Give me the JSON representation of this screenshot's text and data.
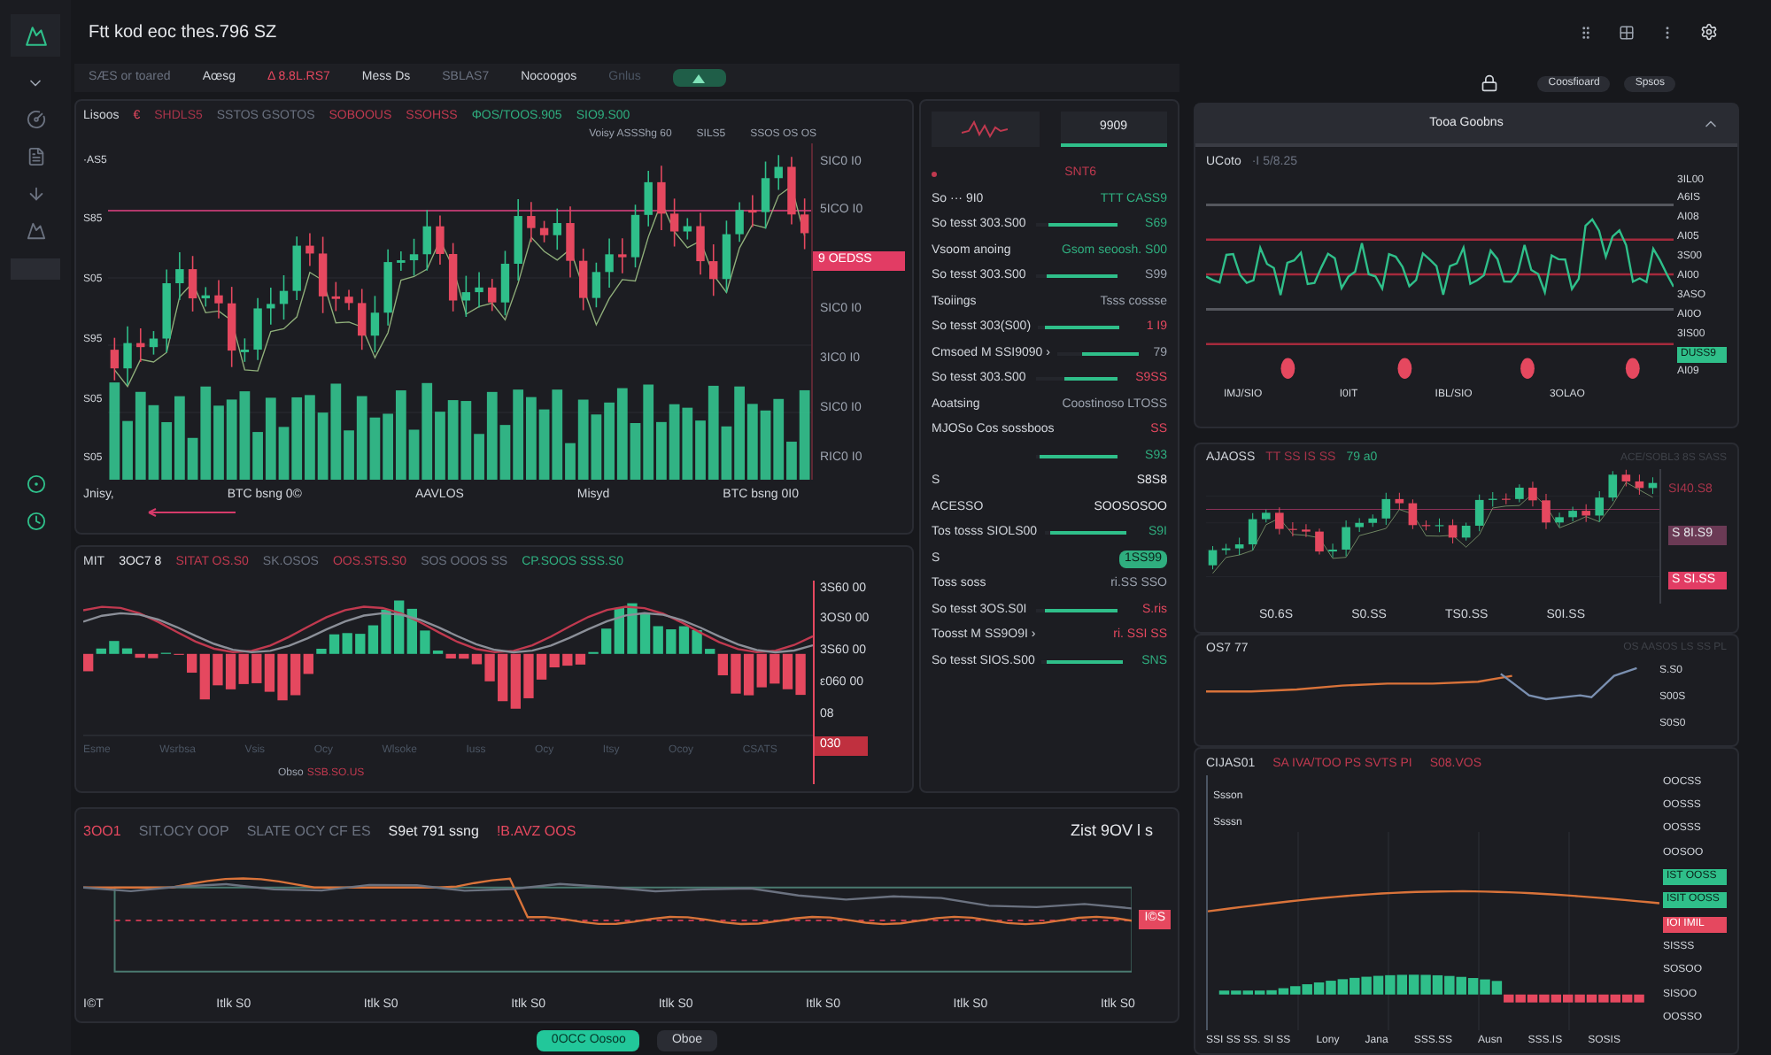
{
  "app": {
    "title": "Ftt kod eoc thes.796 SZ"
  },
  "toolbar": {
    "buttons": [
      "Coosfioard",
      "Spsos"
    ]
  },
  "filters": [
    {
      "label": "SÆS or toared",
      "color": "#6b7280"
    },
    {
      "label": "Aœsg",
      "color": "#d1d5db"
    },
    {
      "label": "Δ 8.8L.RS7",
      "color": "#e5485f"
    },
    {
      "label": "Mess Ds",
      "color": "#d1d5db"
    },
    {
      "label": "SBLAS7",
      "color": "#6b7280"
    },
    {
      "label": "Nocoogos",
      "color": "#d1d5db"
    },
    {
      "label": "Gnlus",
      "color": "#4b5563"
    }
  ],
  "main_chart": {
    "header": [
      {
        "text": "Lisoos",
        "color": "#d1d5db"
      },
      {
        "text": "€",
        "color": "#e5485f"
      },
      {
        "text": "SHDLS5",
        "color": "#a8344a"
      },
      {
        "text": "SSTOS GSOTOS",
        "color": "#6b7280"
      },
      {
        "text": "SOBOOUS",
        "color": "#c0394f"
      },
      {
        "text": "SSOHSS",
        "color": "#c0394f"
      },
      {
        "text": "ΦOS/TOOS.905",
        "color": "#2fae7f"
      },
      {
        "text": "SIO9.S00",
        "color": "#2fae7f"
      }
    ],
    "notes": [
      "Voisy ASSShg 60",
      "SILS5",
      "SSOS OS OS"
    ],
    "left_ticks": [
      "·AS5",
      "S85",
      "S05",
      "S95",
      "S05",
      "S05"
    ],
    "right_ticks": [
      "SIC0 I0",
      "5ICO I0",
      "SIC0 I0",
      "3IC0 I0",
      "SIC0 I0",
      "RIC0 I0"
    ],
    "price_badge": "9 OEDSS",
    "x_labels": [
      "Jnisy,",
      "BTC bsng 0©",
      "AAVLOS",
      "Misyd",
      "BTC bsng 0I0"
    ]
  },
  "macd": {
    "header": [
      {
        "text": "MIT",
        "color": "#d1d5db"
      },
      {
        "text": "3OC7 8",
        "color": "#e5e7eb"
      },
      {
        "text": "SITAT OS.S0",
        "color": "#c0394f"
      },
      {
        "text": "SK.OSOS",
        "color": "#6b7280"
      },
      {
        "text": "OOS.STS.S0",
        "color": "#c0394f"
      },
      {
        "text": "SOS OOOS SS",
        "color": "#6b7280"
      },
      {
        "text": "CP.SOOS SSS.S0",
        "color": "#2fae7f"
      }
    ],
    "right_ticks": [
      "3S60 00",
      "3OS0 00",
      "3S60 00",
      "ε060 00",
      "08"
    ],
    "badge": "030",
    "x_labels": [
      "Esme",
      "Wsrbsa",
      "Vsis",
      "Ocy",
      "Wlsoke",
      "Iuss",
      "Ocy",
      "Itsy",
      "Ocoy",
      "CSATS"
    ],
    "footnote_label": "Obso",
    "footnote_value": "SSB.SO.US"
  },
  "side_panel": {
    "tabs": [
      {
        "kind": "sparkline",
        "selected": false
      },
      {
        "kind": "text",
        "label": "9909",
        "selected": true
      }
    ],
    "rows": [
      {
        "kind": "heading",
        "value": "SNT6",
        "color": "#c0394f"
      },
      {
        "kind": "text",
        "label": "So ··· 9I0",
        "value": "TTT CASS9",
        "color": "#2fae7f"
      },
      {
        "kind": "bar",
        "label": "So tesst 303.S00",
        "level": 0.85,
        "value": "S69",
        "color": "#2fae7f"
      },
      {
        "kind": "text",
        "label": "Vsoom anoing",
        "value": "Gsom seoosh. S00",
        "color": "#2fae7f"
      },
      {
        "kind": "bar",
        "label": "So tesst 303.S00",
        "level": 0.88,
        "value": "S99",
        "color": "#9ca3af"
      },
      {
        "kind": "text",
        "label": "Tsoiings",
        "value": "Tsss cossse",
        "color": "#9ca3af"
      },
      {
        "kind": "bar",
        "label": "So tesst 303(S00)",
        "level": 0.92,
        "value": "1 I9",
        "color": "#e5485f"
      },
      {
        "kind": "bar",
        "label": "Cmsoed M SSI9090 ›",
        "level": 0.7,
        "value": "79",
        "color": "#9ca3af"
      },
      {
        "kind": "bar",
        "label": "So tesst 303.S00",
        "level": 0.65,
        "value": "S9SS",
        "color": "#e5485f"
      },
      {
        "kind": "text",
        "label": "Aoatsing",
        "value": "Coostinoso LTOSS",
        "color": "#9ca3af"
      },
      {
        "kind": "text",
        "label": "MJOSo Cos sossboos",
        "value": "SS",
        "color": "#e5485f"
      },
      {
        "kind": "bar",
        "level": 0.95,
        "value": "S93",
        "color": "#2fae7f"
      },
      {
        "kind": "text",
        "label": "S",
        "value": "S8S8",
        "color": "#e5e7eb"
      },
      {
        "kind": "text",
        "label": "ACESSO",
        "value": "SOOSOSOO",
        "color": "#e5e7eb"
      },
      {
        "kind": "bar",
        "label": "Tos tosss SIOLS00",
        "level": 0.92,
        "value": "S9I",
        "color": "#2fae7f"
      },
      {
        "kind": "badge",
        "label": "S",
        "value": "1SS99",
        "color": "#2fae7f"
      },
      {
        "kind": "text",
        "label": "Toss soss",
        "value": "ri.SS SSO",
        "color": "#9ca3af"
      },
      {
        "kind": "bar",
        "label": "So tesst 3OS.S0I",
        "level": 0.9,
        "value": "S.ris",
        "color": "#e5485f"
      },
      {
        "kind": "text",
        "label": "Toosst M SS9O9I ›",
        "value": "ri. SSI SS",
        "color": "#e5485f"
      },
      {
        "kind": "bar",
        "label": "So tesst SIOS.S00",
        "level": 0.95,
        "value": "SNS",
        "color": "#2fae7f"
      }
    ]
  },
  "timeline": {
    "header": [
      {
        "text": "3OO1",
        "color": "#e5485f"
      },
      {
        "text": "SIT.OCY OOP",
        "color": "#6b7280"
      },
      {
        "text": "SLATE OCY CF ES",
        "color": "#6b7280"
      },
      {
        "text": "S9et 791 ssng",
        "color": "#e5e7eb"
      },
      {
        "text": "!B.AVZ OOS",
        "color": "#e5485f"
      }
    ],
    "right_title": "Zist 9OV l s",
    "badge": "I©S",
    "x_labels": [
      "I©T",
      "Itlk S0",
      "Itlk S0",
      "Itlk S0",
      "Itlk S0",
      "Itlk S0",
      "Itlk S0",
      "Itlk S0"
    ]
  },
  "actions": [
    {
      "label": "0OCC Oosoo",
      "primary": true
    },
    {
      "label": "Oboe",
      "primary": false
    }
  ],
  "top_chart": {
    "title": "Tooa Goobns",
    "expanded": true,
    "legend": [
      "UCoto",
      "·I 5/8.25"
    ],
    "right_ticks": [
      "3IL00",
      "A6IS",
      "AI08",
      "AI05",
      "3S00",
      "AI00",
      "3ASO",
      "AI0O",
      "3IS00",
      "AI09"
    ],
    "badge": "DUSS9",
    "x_labels": [
      "IMJ/SIO",
      "I0IT",
      "IBL/SIO",
      "3OLAO"
    ]
  },
  "candle_chart": {
    "header": [
      {
        "text": "AJAOSS",
        "color": "#d1d5db"
      },
      {
        "text": "TT SS IS SS",
        "color": "#a8344a"
      },
      {
        "text": "79 a0",
        "color": "#2fae7f"
      }
    ],
    "corner": "ACE/SOBL3 8S SASS",
    "price": "SI40.S8",
    "badges": [
      {
        "text": "S 8I.S9",
        "kind": "muted"
      },
      {
        "text": "S SI.SS",
        "kind": "alert"
      }
    ],
    "x_labels": [
      "S0.6S",
      "S0.SS",
      "TS0.SS",
      "S0I.SS"
    ]
  },
  "trend_chart": {
    "title": "OS7 77",
    "corner": "OS AASOS LS SS PL",
    "right_ticks": [
      "S.S0",
      "S00S",
      "S0S0"
    ]
  },
  "volume_chart": {
    "header": [
      {
        "text": "CIJAS01",
        "color": "#d1d5db"
      },
      {
        "text": "SA IVA/TOO PS SVTS PI",
        "color": "#c0394f"
      },
      {
        "text": "S08.VOS",
        "color": "#c0394f"
      }
    ],
    "left_labels": [
      "Ssson",
      "Ssssn"
    ],
    "right_ticks": [
      "OOCSS",
      "OOSSS",
      "OOSSS",
      "OOSOO",
      "SISSS",
      "SOSOO",
      "SISOO",
      "OOSSO"
    ],
    "badges": [
      {
        "text": "IST OOSS",
        "kind": "up"
      },
      {
        "text": "ISIT OOSS",
        "kind": "up"
      },
      {
        "text": "IOI IMIL",
        "kind": "down"
      }
    ],
    "x_labels": [
      "SSI SS SS. SI SS",
      "Lony",
      "Jana",
      "SSS.SS",
      "Ausn",
      "SSS.IS",
      "SOSIS"
    ]
  }
}
